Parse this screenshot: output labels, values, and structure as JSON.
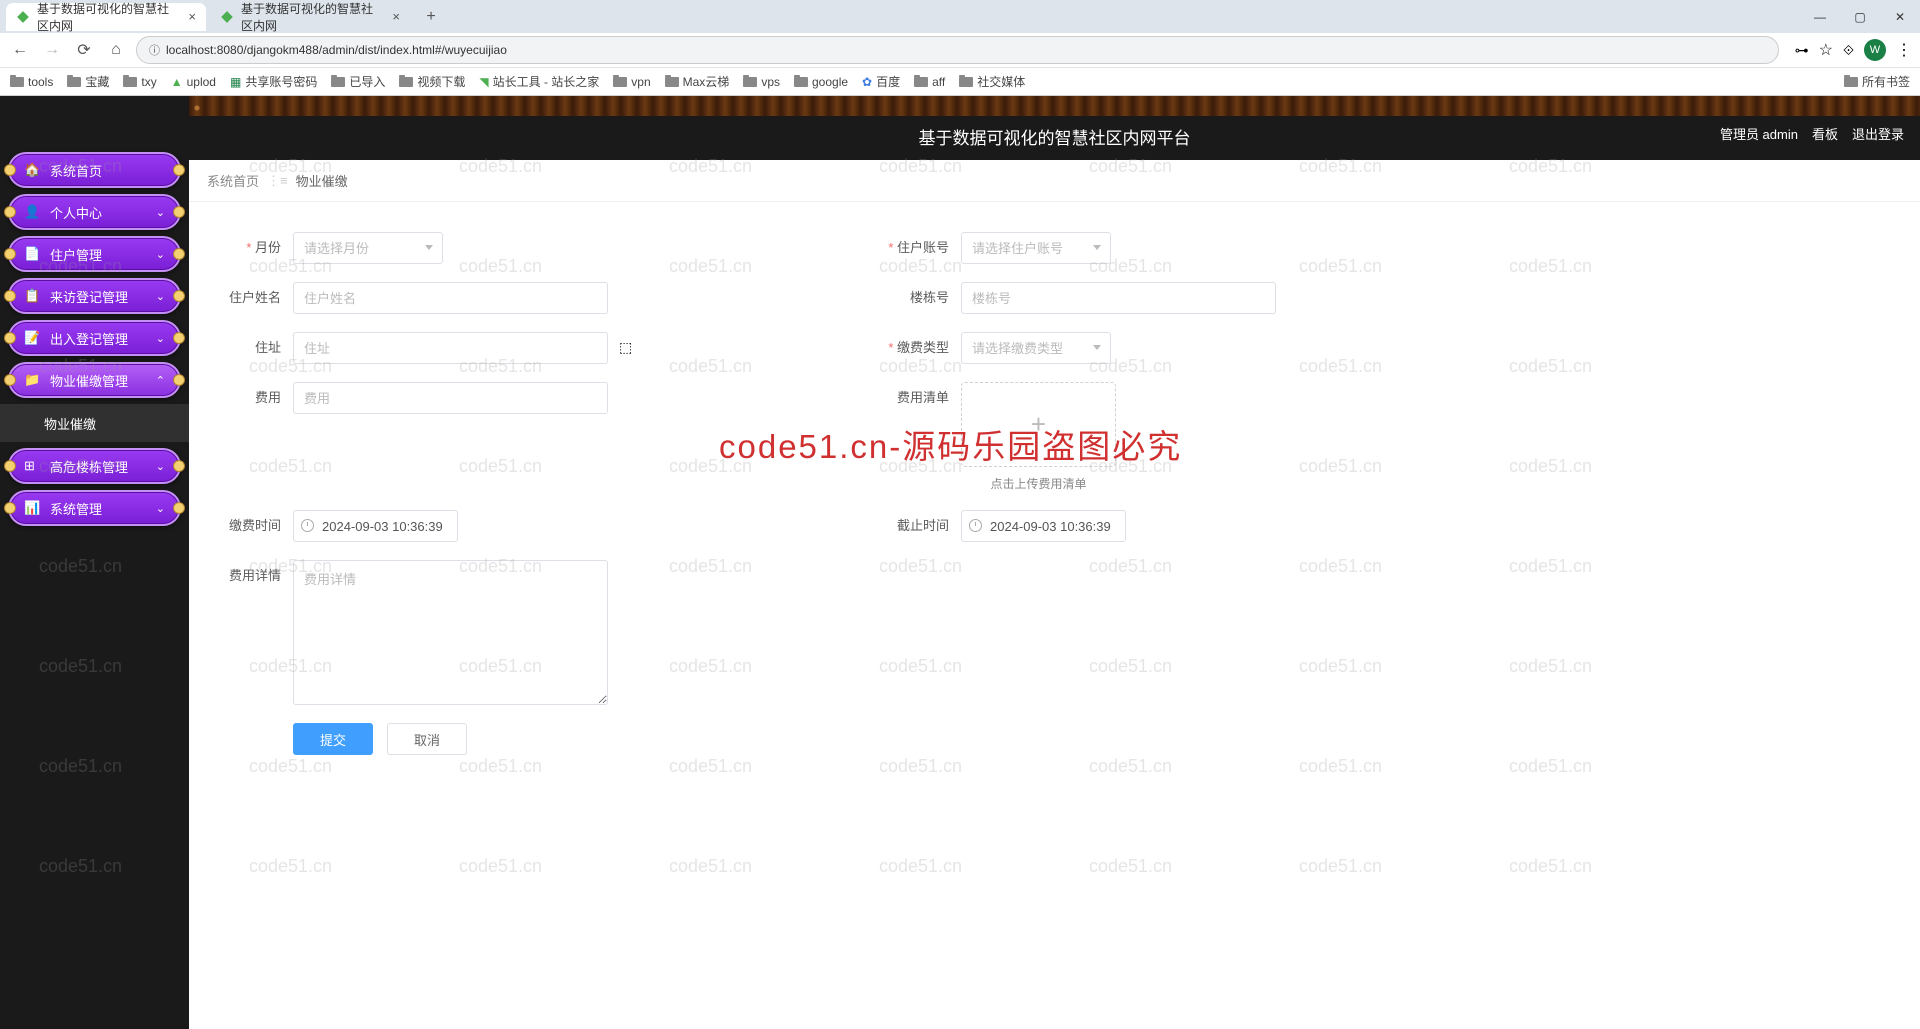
{
  "browser": {
    "tabs": [
      {
        "title": "基于数据可视化的智慧社区内网",
        "active": true
      },
      {
        "title": "基于数据可视化的智慧社区内网",
        "active": false
      }
    ],
    "url": "localhost:8080/djangokm488/admin/dist/index.html#/wuyecuijiao",
    "avatar_letter": "W",
    "bookmarks": [
      "tools",
      "宝藏",
      "txy",
      "uplod",
      "共享账号密码",
      "已导入",
      "视频下载",
      "站长工具 - 站长之家",
      "vpn",
      "Max云梯",
      "vps",
      "google",
      "百度",
      "aff",
      "社交媒体"
    ],
    "all_bookmarks": "所有书签"
  },
  "sidebar": {
    "items": [
      {
        "icon": "🏠",
        "label": "系统首页",
        "arrow": ""
      },
      {
        "icon": "👤",
        "label": "个人中心",
        "arrow": "⌄"
      },
      {
        "icon": "📄",
        "label": "住户管理",
        "arrow": "⌄"
      },
      {
        "icon": "📋",
        "label": "来访登记管理",
        "arrow": "⌄"
      },
      {
        "icon": "📝",
        "label": "出入登记管理",
        "arrow": "⌄"
      },
      {
        "icon": "📁",
        "label": "物业催缴管理",
        "arrow": "⌃",
        "active": true
      },
      {
        "icon": "⊞",
        "label": "高危楼栋管理",
        "arrow": "⌄"
      },
      {
        "icon": "📊",
        "label": "系统管理",
        "arrow": "⌄"
      }
    ],
    "sub_item": "物业催缴"
  },
  "header": {
    "title": "基于数据可视化的智慧社区内网平台",
    "admin": "管理员 admin",
    "kanban": "看板",
    "logout": "退出登录"
  },
  "breadcrumb": {
    "home": "系统首页",
    "sep": "⋮≡",
    "current": "物业催缴"
  },
  "form": {
    "month": {
      "label": "月份",
      "placeholder": "请选择月份"
    },
    "account": {
      "label": "住户账号",
      "placeholder": "请选择住户账号"
    },
    "name": {
      "label": "住户姓名",
      "placeholder": "住户姓名"
    },
    "building": {
      "label": "楼栋号",
      "placeholder": "楼栋号"
    },
    "address": {
      "label": "住址",
      "placeholder": "住址"
    },
    "fee_type": {
      "label": "缴费类型",
      "placeholder": "请选择缴费类型"
    },
    "fee": {
      "label": "费用",
      "placeholder": "费用"
    },
    "bill": {
      "label": "费用清单",
      "upload_tip": "点击上传费用清单"
    },
    "pay_time": {
      "label": "缴费时间",
      "value": "2024-09-03 10:36:39"
    },
    "deadline": {
      "label": "截止时间",
      "value": "2024-09-03 10:36:39"
    },
    "detail": {
      "label": "费用详情",
      "placeholder": "费用详情"
    },
    "submit": "提交",
    "cancel": "取消"
  },
  "watermark": {
    "text": "code51.cn",
    "red": "code51.cn-源码乐园盗图必究"
  }
}
